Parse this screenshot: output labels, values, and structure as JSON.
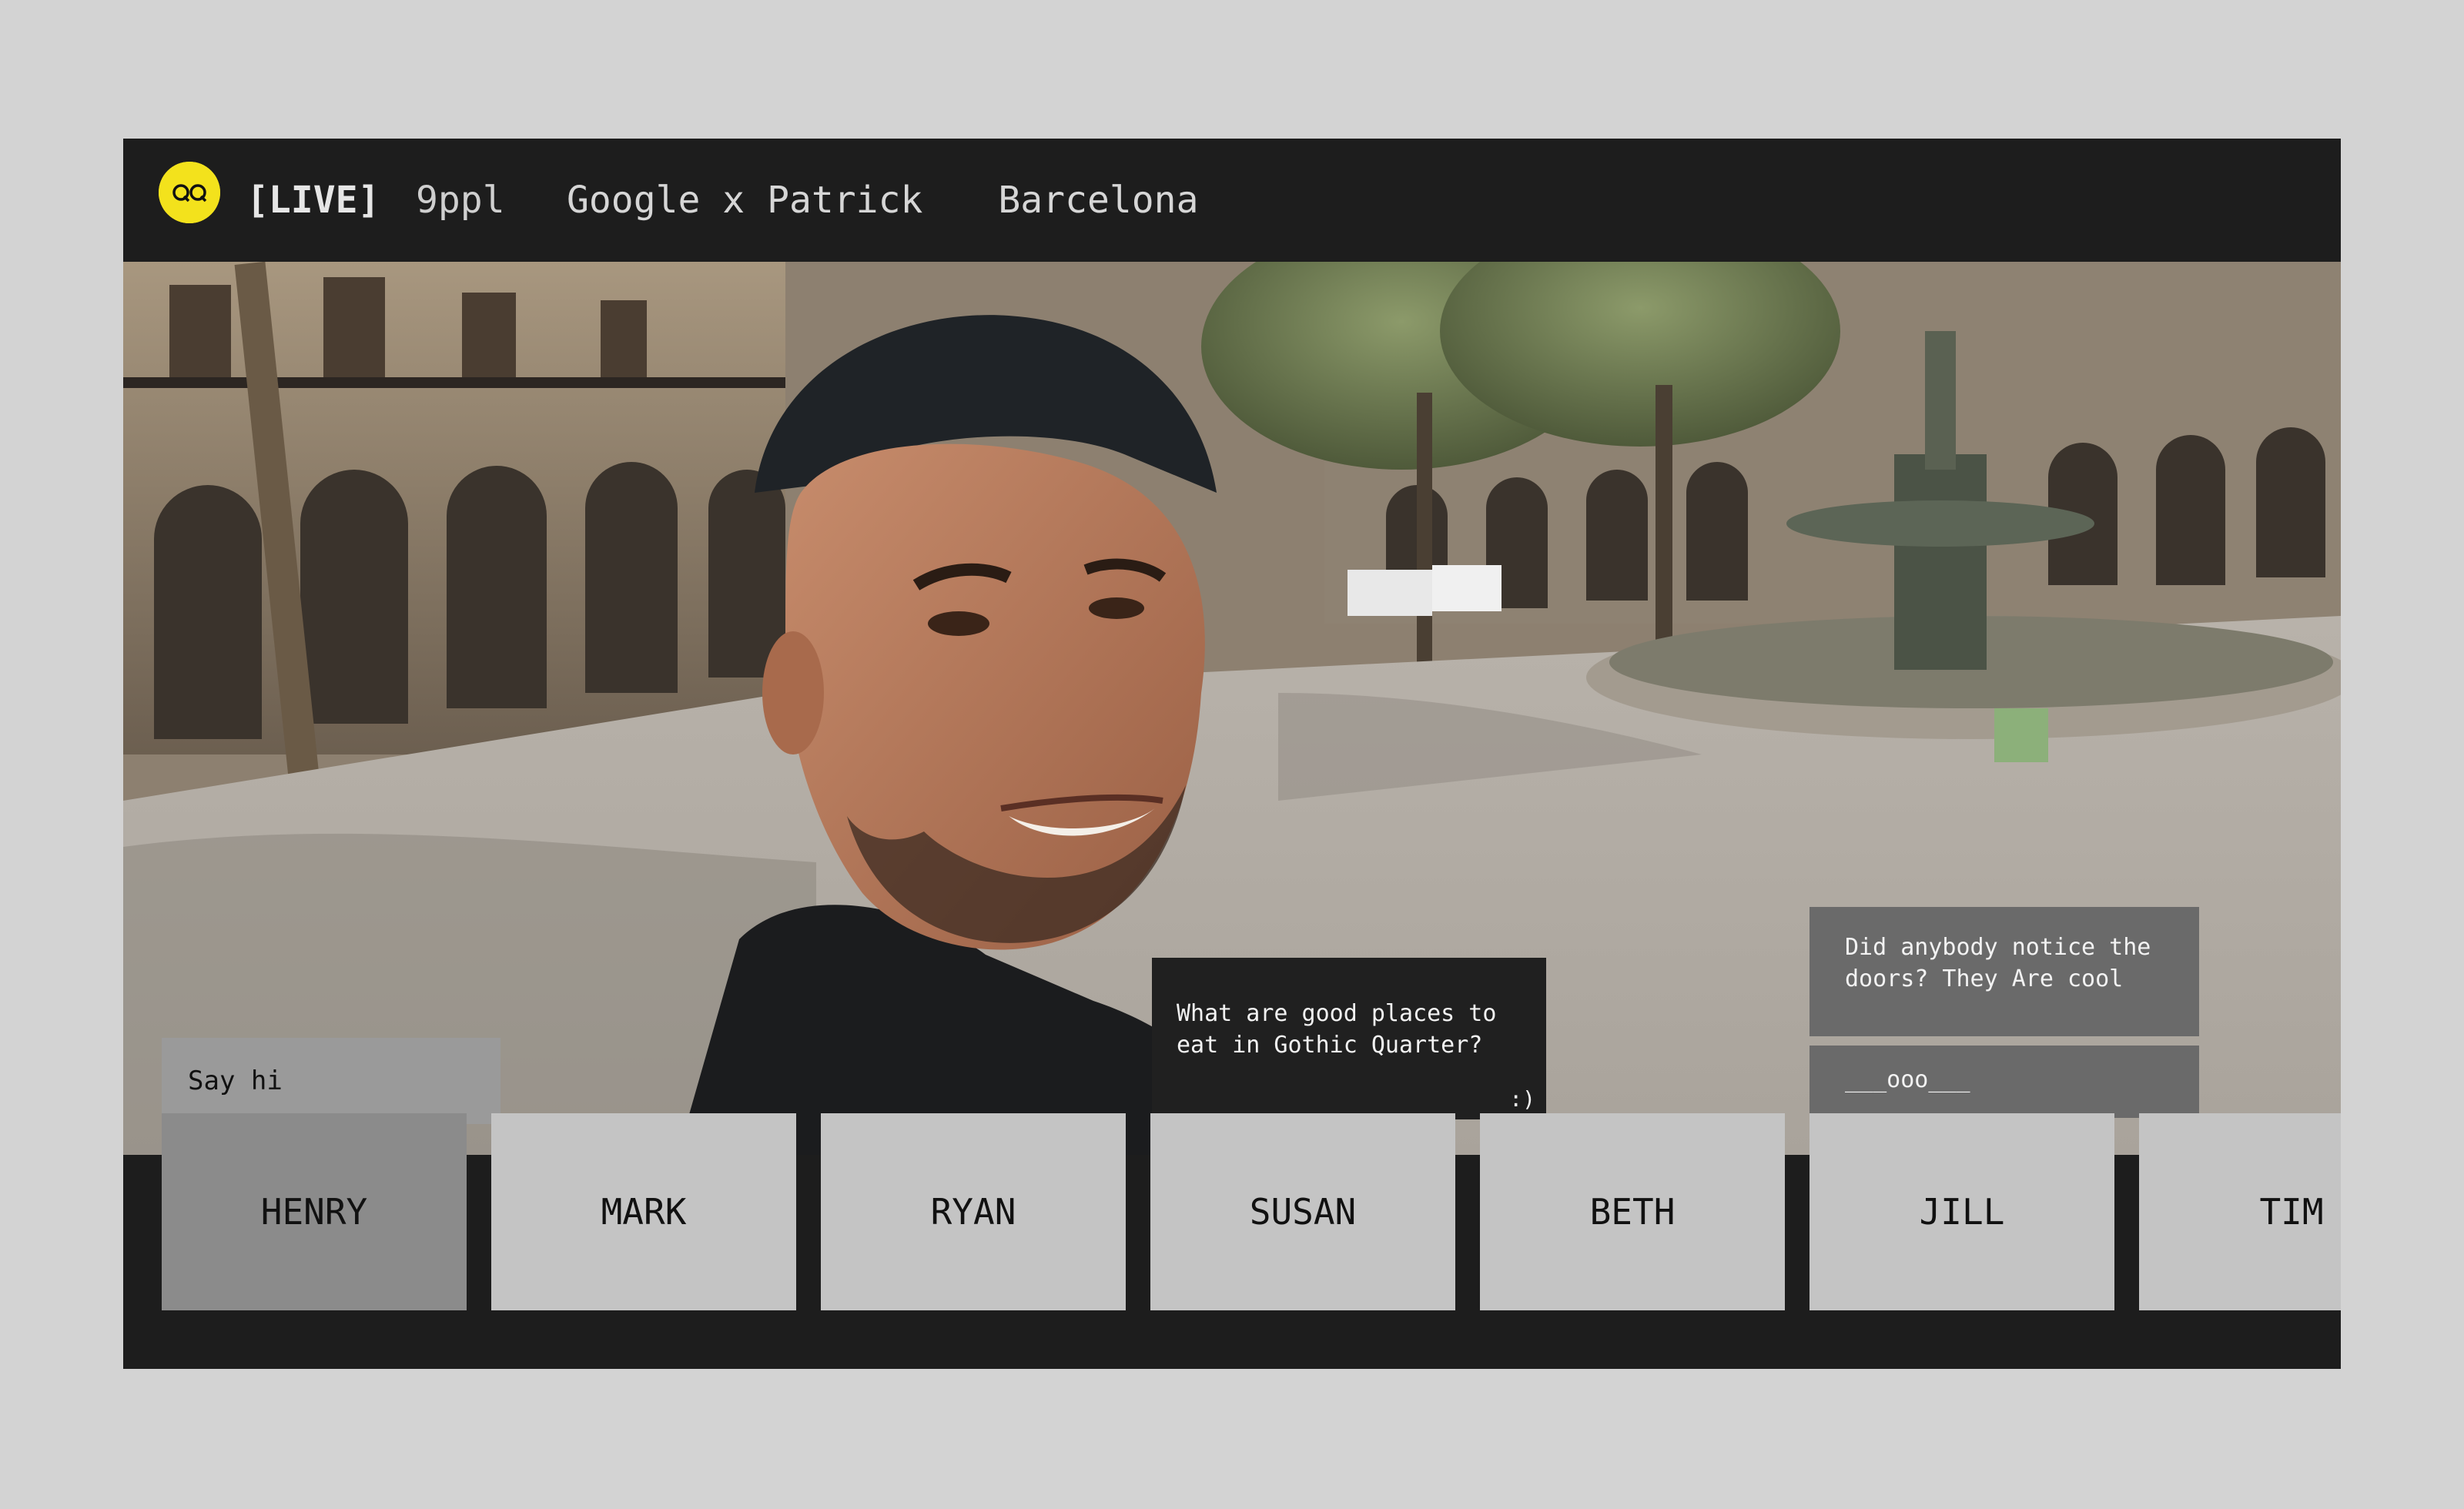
{
  "header": {
    "logo": "qq-logo",
    "live_label": "[LIVE]",
    "viewer_count": "9ppl",
    "title_left": "Google x Patrick",
    "title_icon": "airplane-icon",
    "title_right": "Barcelona"
  },
  "chat": {
    "input_placeholder": "Say hi",
    "messages": [
      {
        "text": "What are good places to eat in Gothic Quarter?",
        "reaction": ":)"
      },
      {
        "text": "Did anybody notice the doors? They Are cool"
      },
      {
        "text": "___ooo___"
      }
    ]
  },
  "participants": [
    {
      "name": "HENRY",
      "active": true
    },
    {
      "name": "MARK",
      "active": false
    },
    {
      "name": "RYAN",
      "active": false
    },
    {
      "name": "SUSAN",
      "active": false
    },
    {
      "name": "BETH",
      "active": false
    },
    {
      "name": "JILL",
      "active": false
    },
    {
      "name": "TIM",
      "active": false
    }
  ],
  "colors": {
    "logo_yellow": "#f3e21c",
    "header_bg": "#1d1d1d",
    "tile_bg": "#c4c4c4",
    "tile_active_bg": "#8b8b8b"
  }
}
